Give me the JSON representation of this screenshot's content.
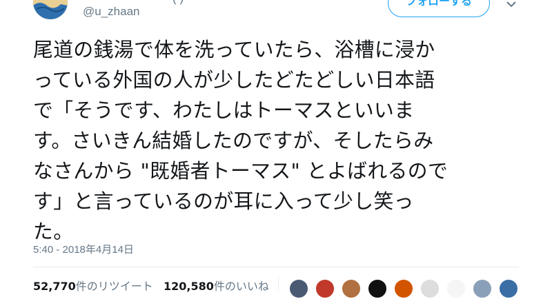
{
  "author": {
    "handle": "@u_zhaan",
    "name_fragment": "(         )"
  },
  "follow_button": {
    "label": "フォローする"
  },
  "tweet": {
    "lines": [
      "尾道の銭湯で体を洗っていたら、浴槽に浸か",
      "っている外国の人が少したどたどしい日本語",
      "で「そうです、わたしはトーマスといいま",
      "す。さいきん結婚したのですが、そしたらみ",
      "なさんから \"既婚者トーマス\" とよばれるので",
      "す」と言っているのが耳に入って少し笑っ",
      "た。"
    ],
    "timestamp": "5:40 - 2018年4月14日"
  },
  "stats": {
    "retweets": {
      "count": "52,770",
      "label": "件のリツイート"
    },
    "likes": {
      "count": "120,580",
      "label": "件のいいね"
    }
  },
  "likers": [
    {
      "name": "liker-avatar-1",
      "color": "#4a5a73"
    },
    {
      "name": "liker-avatar-2",
      "color": "#c0392b"
    },
    {
      "name": "liker-avatar-3",
      "color": "#b07040"
    },
    {
      "name": "liker-avatar-4",
      "color": "#111111"
    },
    {
      "name": "liker-avatar-5",
      "color": "#d35400"
    },
    {
      "name": "liker-avatar-6",
      "color": "#dddddd"
    },
    {
      "name": "liker-avatar-7",
      "color": "#f5f5f5"
    },
    {
      "name": "liker-avatar-8",
      "color": "#8aa0b8"
    },
    {
      "name": "liker-avatar-9",
      "color": "#3a6ea5"
    }
  ],
  "colors": {
    "accent": "#1da1f2",
    "secondary_text": "#657786",
    "primary_text": "#14171a"
  }
}
